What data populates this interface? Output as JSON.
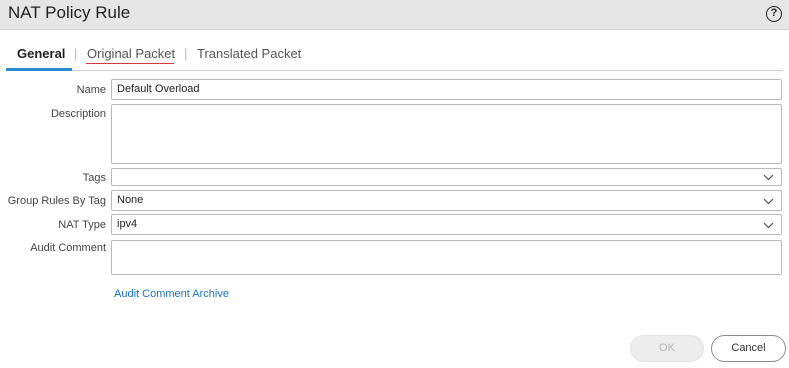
{
  "dialog": {
    "title": "NAT Policy Rule",
    "help_icon": "?"
  },
  "tabs": [
    {
      "label": "General",
      "active": true
    },
    {
      "label": "Original Packet",
      "active": false
    },
    {
      "label": "Translated Packet",
      "active": false
    }
  ],
  "tab_separator": "|",
  "form": {
    "name": {
      "label": "Name",
      "value": "Default Overload"
    },
    "description": {
      "label": "Description",
      "value": ""
    },
    "tags": {
      "label": "Tags",
      "value": ""
    },
    "group_rules_by_tag": {
      "label": "Group Rules By Tag",
      "value": "None"
    },
    "nat_type": {
      "label": "NAT Type",
      "value": "ipv4"
    },
    "audit_comment": {
      "label": "Audit Comment",
      "value": ""
    }
  },
  "audit_comment_archive_link": "Audit Comment Archive",
  "buttons": {
    "ok": "OK",
    "cancel": "Cancel"
  },
  "colors": {
    "active_tab_underline": "#2a8bd4",
    "link": "#1a73c4",
    "titlebar_bg": "#e6e6e6"
  }
}
